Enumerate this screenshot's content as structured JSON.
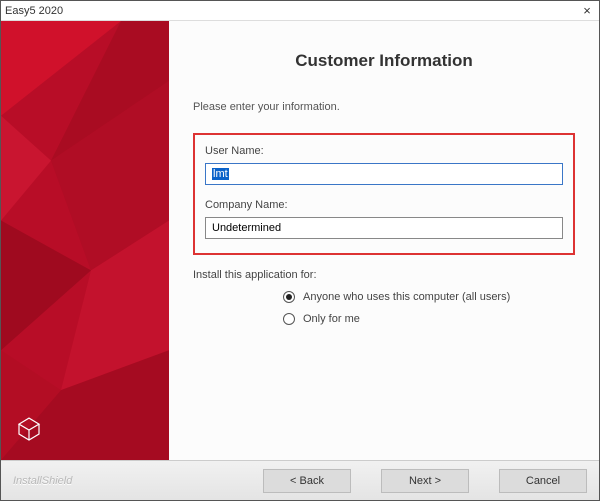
{
  "window": {
    "title": "Easy5 2020",
    "close_symbol": "×"
  },
  "page": {
    "heading": "Customer Information",
    "instruction": "Please enter your information."
  },
  "fields": {
    "username_label": "User Name:",
    "username_value": "lmt",
    "company_label": "Company Name:",
    "company_value": "Undetermined"
  },
  "install": {
    "prompt": "Install this application for:",
    "options": {
      "all_users": "Anyone who uses this computer (all users)",
      "only_me": "Only for me"
    },
    "selected": "all_users"
  },
  "footer": {
    "brand": "InstallShield",
    "back_label": "< Back",
    "next_label": "Next >",
    "cancel_label": "Cancel"
  },
  "colors": {
    "accent": "#c21030",
    "highlight_border": "#d33",
    "focus_border": "#3a76c7"
  }
}
